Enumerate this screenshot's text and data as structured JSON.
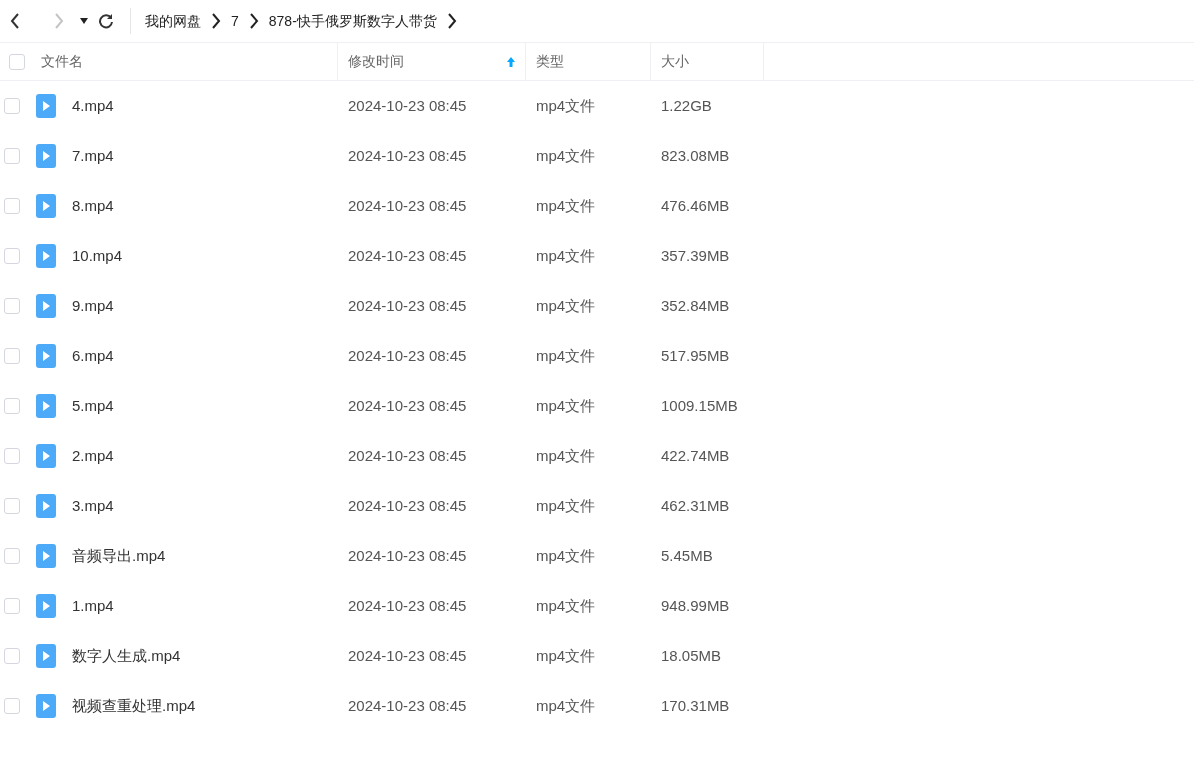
{
  "nav": {
    "back_disabled": false,
    "forward_disabled": true
  },
  "breadcrumbs": [
    "我的网盘",
    "7",
    "878-快手俄罗斯数字人带货"
  ],
  "table": {
    "select_all_checked": false,
    "columns": [
      {
        "label": "文件名",
        "sorted": false
      },
      {
        "label": "修改时间",
        "sorted": true
      },
      {
        "label": "类型",
        "sorted": false
      },
      {
        "label": "大小",
        "sorted": false
      }
    ],
    "rows": [
      {
        "name": "4.mp4",
        "modified": "2024-10-23 08:45",
        "type": "mp4文件",
        "size": "1.22GB",
        "checked": false
      },
      {
        "name": "7.mp4",
        "modified": "2024-10-23 08:45",
        "type": "mp4文件",
        "size": "823.08MB",
        "checked": false
      },
      {
        "name": "8.mp4",
        "modified": "2024-10-23 08:45",
        "type": "mp4文件",
        "size": "476.46MB",
        "checked": false
      },
      {
        "name": "10.mp4",
        "modified": "2024-10-23 08:45",
        "type": "mp4文件",
        "size": "357.39MB",
        "checked": false
      },
      {
        "name": "9.mp4",
        "modified": "2024-10-23 08:45",
        "type": "mp4文件",
        "size": "352.84MB",
        "checked": false
      },
      {
        "name": "6.mp4",
        "modified": "2024-10-23 08:45",
        "type": "mp4文件",
        "size": "517.95MB",
        "checked": false
      },
      {
        "name": "5.mp4",
        "modified": "2024-10-23 08:45",
        "type": "mp4文件",
        "size": "1009.15MB",
        "checked": false
      },
      {
        "name": "2.mp4",
        "modified": "2024-10-23 08:45",
        "type": "mp4文件",
        "size": "422.74MB",
        "checked": false
      },
      {
        "name": "3.mp4",
        "modified": "2024-10-23 08:45",
        "type": "mp4文件",
        "size": "462.31MB",
        "checked": false
      },
      {
        "name": "音频导出.mp4",
        "modified": "2024-10-23 08:45",
        "type": "mp4文件",
        "size": "5.45MB",
        "checked": false
      },
      {
        "name": "1.mp4",
        "modified": "2024-10-23 08:45",
        "type": "mp4文件",
        "size": "948.99MB",
        "checked": false
      },
      {
        "name": "数字人生成.mp4",
        "modified": "2024-10-23 08:45",
        "type": "mp4文件",
        "size": "18.05MB",
        "checked": false
      },
      {
        "name": "视频查重处理.mp4",
        "modified": "2024-10-23 08:45",
        "type": "mp4文件",
        "size": "170.31MB",
        "checked": false
      }
    ]
  }
}
